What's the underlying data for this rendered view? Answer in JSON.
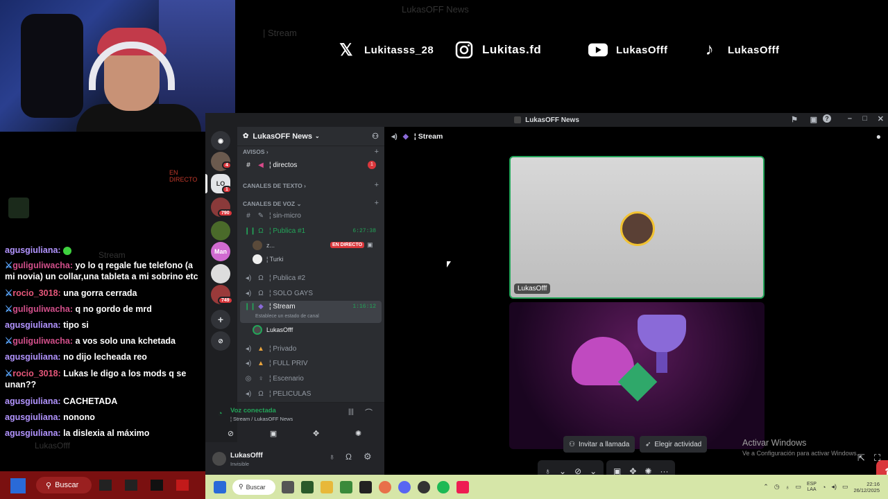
{
  "webcam": {
    "label": "webcam"
  },
  "banner": {
    "ghost_title": "LukasOFF News",
    "ghost_stream": "| Stream",
    "socials": [
      {
        "icon": "x-icon",
        "handle": "Lukitasss_28"
      },
      {
        "icon": "instagram-icon",
        "handle": "Lukitas.fd"
      },
      {
        "icon": "youtube-icon",
        "handle": "LukasOfff"
      },
      {
        "icon": "tiktok-icon",
        "handle": "LukasOfff"
      }
    ]
  },
  "chat": {
    "live_badge": "EN DIRECTO",
    "ghost_stream": "Stream",
    "ghost_user": "LukasOfff",
    "messages": [
      {
        "user": "agusgiuliana:",
        "text": "",
        "style": "u1",
        "sword": false
      },
      {
        "user": "guliguliwacha:",
        "text": "yo lo q regale fue telefono (a mi novia) un collar,una tableta a mi sobrino etc",
        "style": "u2",
        "sword": true
      },
      {
        "user": "rocio_3018:",
        "text": "una gorra cerrada",
        "style": "u3",
        "sword": true
      },
      {
        "user": "guliguliwacha:",
        "text": "q no gordo de mrd",
        "style": "u2",
        "sword": true
      },
      {
        "user": "agusgiuliana:",
        "text": "tipo si",
        "style": "u1",
        "sword": false
      },
      {
        "user": "guliguliwacha:",
        "text": "a vos solo una kchetada",
        "style": "u2",
        "sword": true
      },
      {
        "user": "agusgiuliana:",
        "text": "no dijo lecheada reo",
        "style": "u1",
        "sword": false
      },
      {
        "user": "rocio_3018:",
        "text": "Lukas le digo a los mods q se unan??",
        "style": "u3",
        "sword": true
      },
      {
        "user": "agusgiuliana:",
        "text": "CACHETADA",
        "style": "u1",
        "sword": false
      },
      {
        "user": "agusgiuliana:",
        "text": "nonono",
        "style": "u1",
        "sword": false
      },
      {
        "user": "agusgiuliana:",
        "text": "la dislexia al máximo",
        "style": "u1",
        "sword": false
      }
    ]
  },
  "discord": {
    "window_title": "LukasOFF News",
    "server_name": "LukasOFF News",
    "rail": {
      "badges": [
        "4",
        "1",
        "790",
        "749"
      ],
      "server_labels": [
        "Man"
      ]
    },
    "categories": {
      "avisos": "AVISOS",
      "text": "CANALES DE TEXTO",
      "voice": "CANALES DE VOZ"
    },
    "channels": {
      "directos": "¦ directos",
      "directos_badge": "1",
      "sin_micro": "¦ sin-micro",
      "publica1": "¦ Publica #1",
      "publica1_time": "6:27:38",
      "publica1_member1": "z...",
      "publica1_member2": "¦ Turki",
      "publica2": "¦ Publica #2",
      "solo_gays": "¦ SOLO GAYS",
      "stream": "¦ Stream",
      "stream_time": "1:16:12",
      "stream_status": "Establece un estado de canal",
      "stream_member": "LukasOfff",
      "privado": "¦ Privado",
      "full_priv": "¦ FULL PRIV",
      "escenario": "¦ Escenario",
      "peliculas": "¦ PELICULAS"
    },
    "live_badge": "EN DIRECTO",
    "voice_panel": {
      "status": "Voz conectada",
      "location": "¦ Stream / LukasOFF News"
    },
    "user": {
      "name": "LukasOfff",
      "status": "Invisible"
    },
    "main": {
      "channel_title": "¦ Stream",
      "tile_user": "LukasOfff",
      "invite_label": "Invitar a llamada",
      "activity_label": "Elegir actividad"
    }
  },
  "windows_activation": {
    "title": "Activar Windows",
    "subtitle": "Ve a Configuración para activar Windows."
  },
  "taskbar": {
    "search_left": "Buscar",
    "search": "Buscar",
    "lang": "ESP",
    "lang2": "LAA",
    "time": "22:16",
    "date": "26/12/2025"
  },
  "colors": {
    "discord_bg": "#313338",
    "discord_sidebar": "#2b2d31",
    "discord_rail": "#1e1f22",
    "voice_green": "#23a559",
    "danger": "#da373c",
    "taskbar": "#d6e6a8"
  }
}
